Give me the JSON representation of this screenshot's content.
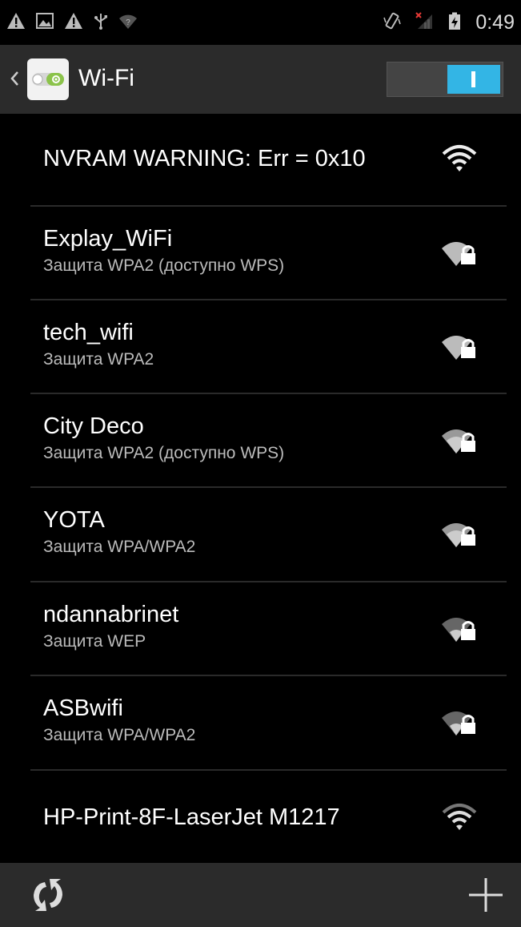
{
  "status_bar": {
    "time": "0:49",
    "left_icons": [
      "warning-icon",
      "image-icon",
      "warning-icon",
      "usb-icon",
      "wifi-question-icon"
    ],
    "right_icons": [
      "vibrate-icon",
      "no-signal-icon",
      "battery-charging-icon"
    ]
  },
  "action_bar": {
    "title": "Wi-Fi",
    "toggle_state": "on"
  },
  "networks": [
    {
      "name": "NVRAM WARNING: Err = 0x10",
      "security": "",
      "locked": false
    },
    {
      "name": "Explay_WiFi",
      "security": "Защита WPA2 (доступно WPS)",
      "locked": true
    },
    {
      "name": "tech_wifi",
      "security": "Защита WPA2",
      "locked": true
    },
    {
      "name": "City Deco",
      "security": "Защита WPA2 (доступно WPS)",
      "locked": true
    },
    {
      "name": "YOTA",
      "security": "Защита WPA/WPA2",
      "locked": true
    },
    {
      "name": "ndannabrinet",
      "security": "Защита WEP",
      "locked": true
    },
    {
      "name": "ASBwifi",
      "security": "Защита WPA/WPA2",
      "locked": true
    },
    {
      "name": "HP-Print-8F-LaserJet M1217",
      "security": "",
      "locked": false
    }
  ],
  "bottom_bar": {
    "left_icon": "scan-icon",
    "right_icon": "add-network-icon"
  },
  "colors": {
    "accent": "#33b5e5",
    "action_bar_bg": "#2b2b2b",
    "background": "#000000"
  }
}
